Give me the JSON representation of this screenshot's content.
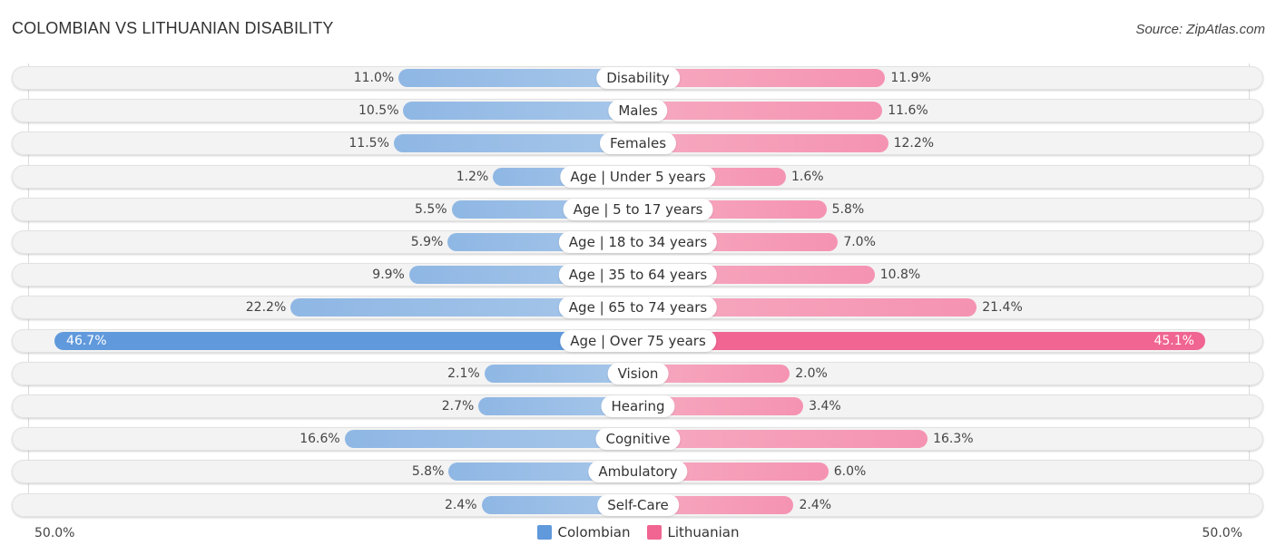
{
  "header": {
    "title": "COLOMBIAN VS LITHUANIAN DISABILITY",
    "source": "Source: ZipAtlas.com"
  },
  "colors": {
    "colombian": "#6099dc",
    "lithuanian": "#f06591",
    "colombian_light": "#9dc0e8",
    "lithuanian_light": "#f6a2bc"
  },
  "chart_data": {
    "type": "bar",
    "orientation": "horizontal-diverging",
    "title": "COLOMBIAN VS LITHUANIAN DISABILITY",
    "categories": [
      "Disability",
      "Males",
      "Females",
      "Age | Under 5 years",
      "Age | 5 to 17 years",
      "Age | 18 to 34 years",
      "Age | 35 to 64 years",
      "Age | 65 to 74 years",
      "Age | Over 75 years",
      "Vision",
      "Hearing",
      "Cognitive",
      "Ambulatory",
      "Self-Care"
    ],
    "series": [
      {
        "name": "Colombian",
        "side": "left",
        "values": [
          11.0,
          10.5,
          11.5,
          1.2,
          5.5,
          5.9,
          9.9,
          22.2,
          46.7,
          2.1,
          2.7,
          16.6,
          5.8,
          2.4
        ],
        "labels": [
          "11.0%",
          "10.5%",
          "11.5%",
          "1.2%",
          "5.5%",
          "5.9%",
          "9.9%",
          "22.2%",
          "46.7%",
          "2.1%",
          "2.7%",
          "16.6%",
          "5.8%",
          "2.4%"
        ]
      },
      {
        "name": "Lithuanian",
        "side": "right",
        "values": [
          11.9,
          11.6,
          12.2,
          1.6,
          5.8,
          7.0,
          10.8,
          21.4,
          45.1,
          2.0,
          3.4,
          16.3,
          6.0,
          2.4
        ],
        "labels": [
          "11.9%",
          "11.6%",
          "12.2%",
          "1.6%",
          "5.8%",
          "7.0%",
          "10.8%",
          "21.4%",
          "45.1%",
          "2.0%",
          "3.4%",
          "16.3%",
          "6.0%",
          "2.4%"
        ]
      }
    ],
    "xlim": [
      0,
      50
    ],
    "axis_labels": {
      "left": "50.0%",
      "right": "50.0%"
    },
    "unit": "%",
    "legend": {
      "position": "bottom-center",
      "entries": [
        "Colombian",
        "Lithuanian"
      ]
    },
    "grid": false
  }
}
